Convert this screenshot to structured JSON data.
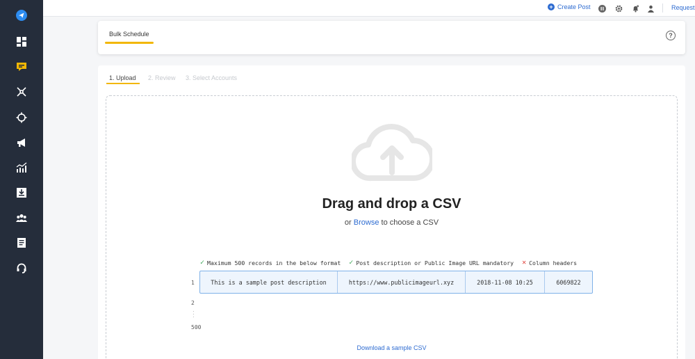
{
  "sidebar": {
    "items": [
      {
        "icon": "paper-plane-icon"
      },
      {
        "icon": "dashboard-icon"
      },
      {
        "icon": "publish-icon",
        "active": true
      },
      {
        "icon": "network-icon"
      },
      {
        "icon": "target-icon"
      },
      {
        "icon": "megaphone-icon"
      },
      {
        "icon": "analytics-icon"
      },
      {
        "icon": "download-icon"
      },
      {
        "icon": "team-icon"
      },
      {
        "icon": "document-icon"
      },
      {
        "icon": "support-headset-icon"
      }
    ],
    "accent_color": "#f2b705"
  },
  "topbar": {
    "create_post": "Create Post",
    "request": "Request"
  },
  "header": {
    "title": "Bulk Schedule",
    "help": "?"
  },
  "steps": [
    {
      "label": "1. Upload",
      "active": true
    },
    {
      "label": "2. Review",
      "active": false
    },
    {
      "label": "3. Select Accounts",
      "active": false
    }
  ],
  "upload": {
    "title": "Drag and drop a CSV",
    "or": "or",
    "browse": "Browse",
    "to_choose": "to choose a CSV",
    "rules": [
      {
        "status": "ok",
        "text": "Maximum 500 records in the below format"
      },
      {
        "status": "ok",
        "text": "Post description or Public Image URL mandatory"
      },
      {
        "status": "no",
        "text": "Column headers"
      }
    ],
    "rows": [
      "1",
      "2",
      "500"
    ],
    "sample": [
      "This is a sample post description",
      "https://www.publicimageurl.xyz",
      "2018-11-08 10:25",
      "6069822"
    ],
    "download": "Download a sample CSV"
  }
}
